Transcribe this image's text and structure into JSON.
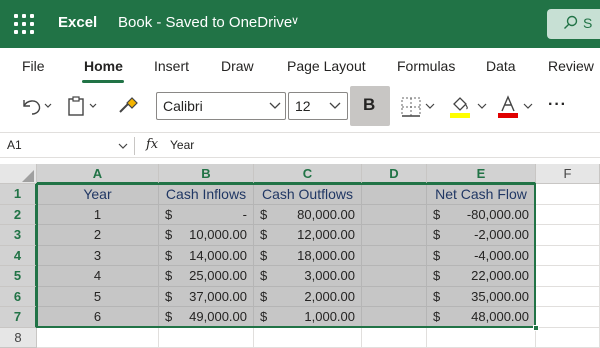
{
  "app": {
    "name": "Excel",
    "document_title": "Book - Saved to OneDrive",
    "search_text": "S"
  },
  "tabs": [
    "File",
    "Home",
    "Insert",
    "Draw",
    "Page Layout",
    "Formulas",
    "Data",
    "Review"
  ],
  "active_tab": "Home",
  "ribbon": {
    "font_name": "Calibri",
    "font_size": "12",
    "bold_label": "B",
    "more_label": "···",
    "highlight_color": "#ffff00",
    "font_color": "#e00000"
  },
  "formula_bar": {
    "cell_ref": "A1",
    "fx_label": "fx",
    "content": "Year"
  },
  "grid": {
    "columns": [
      "A",
      "B",
      "C",
      "D",
      "E",
      "F"
    ],
    "rows": [
      "1",
      "2",
      "3",
      "4",
      "5",
      "6",
      "7",
      "8"
    ],
    "header": {
      "year": "Year",
      "inflows": "Cash Inflows",
      "outflows": "Cash Outflows",
      "net": "Net Cash Flow"
    },
    "currency_symbol": "$",
    "data_rows": [
      {
        "year": "1",
        "inflow": "-",
        "outflow": "80,000.00",
        "net": "-80,000.00"
      },
      {
        "year": "2",
        "inflow": "10,000.00",
        "outflow": "12,000.00",
        "net": "-2,000.00"
      },
      {
        "year": "3",
        "inflow": "14,000.00",
        "outflow": "18,000.00",
        "net": "-4,000.00"
      },
      {
        "year": "4",
        "inflow": "25,000.00",
        "outflow": "3,000.00",
        "net": "22,000.00"
      },
      {
        "year": "5",
        "inflow": "37,000.00",
        "outflow": "2,000.00",
        "net": "35,000.00"
      },
      {
        "year": "6",
        "inflow": "49,000.00",
        "outflow": "1,000.00",
        "net": "48,000.00"
      }
    ]
  },
  "colors": {
    "excel_green": "#217346",
    "header_text": "#203764",
    "selection_fill": "#c6c6c6"
  }
}
